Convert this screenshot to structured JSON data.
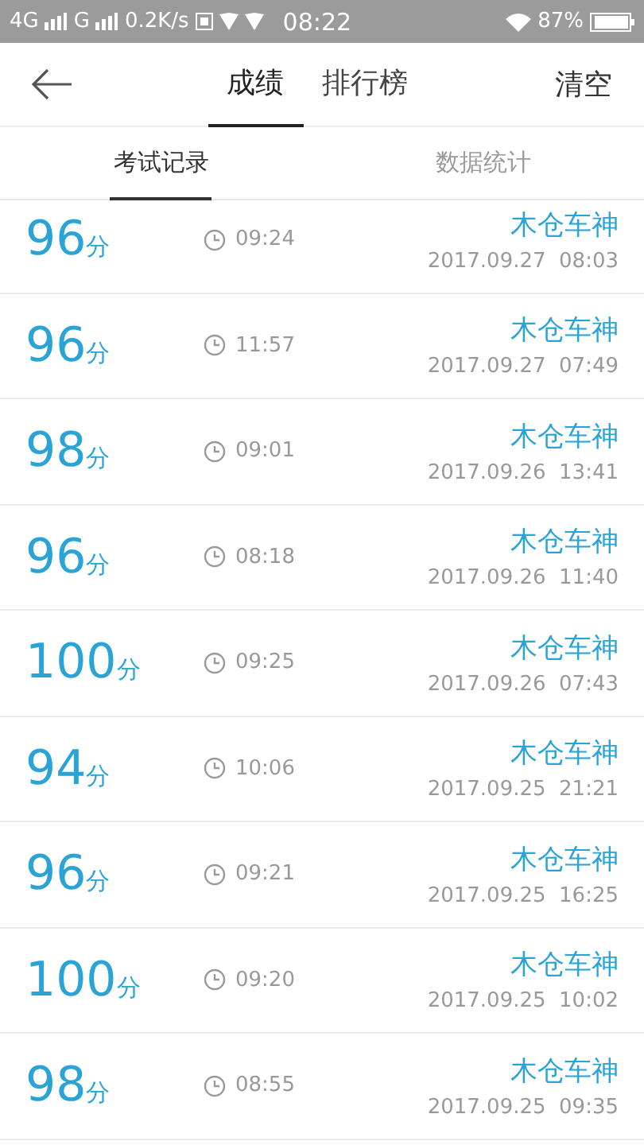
{
  "status_bar": {
    "network_1": "4G",
    "network_2": "G",
    "speed": "0.2K/s",
    "time": "08:22",
    "battery": "87%"
  },
  "header": {
    "tabs": [
      {
        "label": "成绩",
        "selected": true
      },
      {
        "label": "排行榜",
        "selected": false
      }
    ],
    "action": "清空"
  },
  "sub_tabs": [
    {
      "label": "考试记录",
      "selected": true
    },
    {
      "label": "数据统计",
      "selected": false
    }
  ],
  "records": [
    {
      "score": "96",
      "unit": "分",
      "duration": "09:24",
      "name": "木仓车神",
      "date": "2017.09.27",
      "time": "08:03"
    },
    {
      "score": "96",
      "unit": "分",
      "duration": "11:57",
      "name": "木仓车神",
      "date": "2017.09.27",
      "time": "07:49"
    },
    {
      "score": "98",
      "unit": "分",
      "duration": "09:01",
      "name": "木仓车神",
      "date": "2017.09.26",
      "time": "13:41"
    },
    {
      "score": "96",
      "unit": "分",
      "duration": "08:18",
      "name": "木仓车神",
      "date": "2017.09.26",
      "time": "11:40"
    },
    {
      "score": "100",
      "unit": "分",
      "duration": "09:25",
      "name": "木仓车神",
      "date": "2017.09.26",
      "time": "07:43"
    },
    {
      "score": "94",
      "unit": "分",
      "duration": "10:06",
      "name": "木仓车神",
      "date": "2017.09.25",
      "time": "21:21"
    },
    {
      "score": "96",
      "unit": "分",
      "duration": "09:21",
      "name": "木仓车神",
      "date": "2017.09.25",
      "time": "16:25"
    },
    {
      "score": "100",
      "unit": "分",
      "duration": "09:20",
      "name": "木仓车神",
      "date": "2017.09.25",
      "time": "10:02"
    },
    {
      "score": "98",
      "unit": "分",
      "duration": "08:55",
      "name": "木仓车神",
      "date": "2017.09.25",
      "time": "09:35"
    }
  ]
}
